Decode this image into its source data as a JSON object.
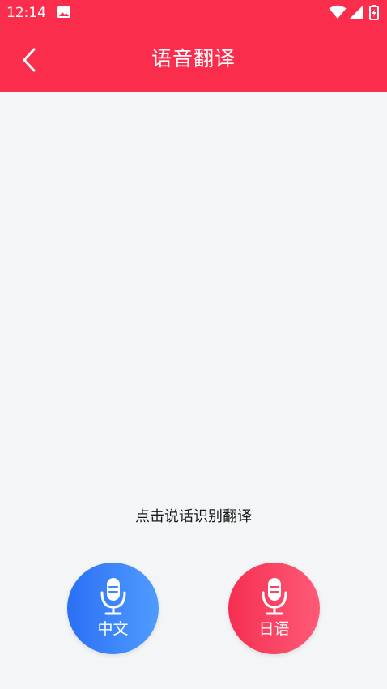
{
  "status_bar": {
    "time": "12:14",
    "icons": [
      "image-icon",
      "wifi-icon",
      "signal-icon",
      "battery-charging-icon"
    ]
  },
  "header": {
    "title": "语音翻译",
    "back_icon": "chevron-left-icon"
  },
  "main": {
    "hint": "点击说话识别翻译"
  },
  "buttons": {
    "chinese": {
      "label": "中文",
      "icon": "microphone-icon",
      "color": "#2b6ff4"
    },
    "japanese": {
      "label": "日语",
      "icon": "microphone-icon",
      "color": "#f52f52"
    }
  },
  "colors": {
    "header_bg": "#fb2d4d",
    "page_bg": "#f4f5f6"
  }
}
